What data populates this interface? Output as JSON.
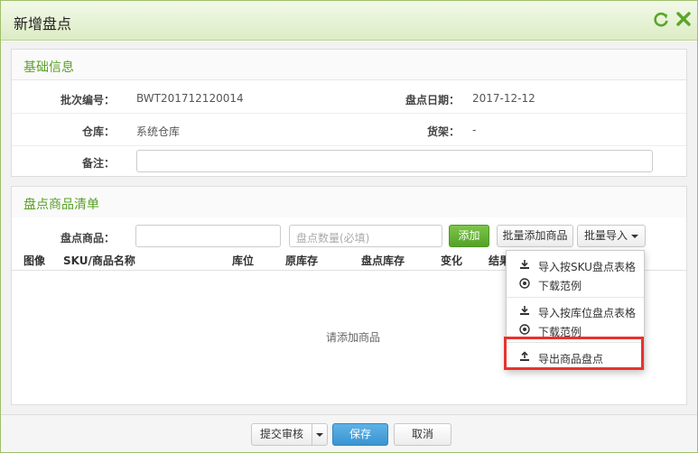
{
  "dialog": {
    "title": "新增盘点",
    "refresh_icon": "refresh-icon",
    "close_icon": "close-icon"
  },
  "basic_info": {
    "heading": "基础信息",
    "batch_label": "批次编号：",
    "batch_value": "BWT201712120014",
    "date_label": "盘点日期：",
    "date_value": "2017-12-12",
    "warehouse_label": "仓库：",
    "warehouse_value": "系统仓库",
    "shelf_label": "货架：",
    "shelf_value": "-",
    "remark_label": "备注：",
    "remark_value": ""
  },
  "goods": {
    "heading": "盘点商品清单",
    "product_label": "盘点商品：",
    "product_value": "",
    "qty_placeholder": "盘点数量(必填)",
    "add_button": "添加",
    "batch_add_button": "批量添加商品",
    "batch_import_button": "批量导入",
    "columns": [
      "图像",
      "SKU/商品名称",
      "库位",
      "原库存",
      "盘点库存",
      "变化",
      "结果"
    ],
    "empty_text": "请添加商品"
  },
  "import_menu": {
    "items": [
      {
        "label": "导入按SKU盘点表格",
        "icon": "download-icon"
      },
      {
        "label": "下载范例",
        "icon": "download-circle-icon"
      },
      {
        "label": "导入按库位盘点表格",
        "icon": "download-icon"
      },
      {
        "label": "下载范例",
        "icon": "download-circle-icon"
      },
      {
        "label": "导出商品盘点",
        "icon": "upload-icon"
      }
    ]
  },
  "footer": {
    "submit_review": "提交审核",
    "save": "保存",
    "cancel": "取消"
  },
  "colors": {
    "accent_green": "#5a9f28",
    "save_blue": "#3a94d1",
    "highlight_red": "#e8322d"
  }
}
